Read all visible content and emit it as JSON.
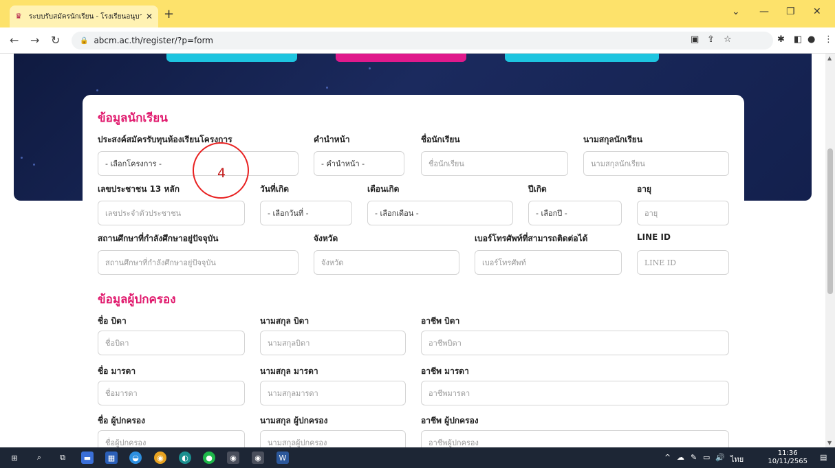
{
  "browser": {
    "tab_title": "ระบบรับสมัครนักเรียน - โรงเรียนอนุบาล",
    "new_tab": "+",
    "url": "abcm.ac.th/register/?p=form",
    "window": {
      "minimize": "—",
      "maximize": "❐",
      "close": "✕",
      "caret": "⌄"
    }
  },
  "student_section": {
    "title": "ข้อมูลนักเรียน",
    "project_label": "ประสงค์สมัครรับทุนห้องเรียนโครงการ",
    "project_value": "- เลือกโครงการ -",
    "prefix_label": "คำนำหน้า",
    "prefix_value": "- คำนำหน้า -",
    "first_name_label": "ชื่อนักเรียน",
    "first_name_placeholder": "ชื่อนักเรียน",
    "last_name_label": "นามสกุลนักเรียน",
    "last_name_placeholder": "นามสกุลนักเรียน",
    "id_label": "เลขประชาชน 13 หลัก",
    "id_placeholder": "เลขประจำตัวประชาชน",
    "birth_day_label": "วันที่เกิด",
    "birth_day_value": "- เลือกวันที่ -",
    "birth_month_label": "เดือนเกิด",
    "birth_month_value": "- เลือกเดือน -",
    "birth_year_label": "ปีเกิด",
    "birth_year_value": "- เลือกปี -",
    "age_label": "อายุ",
    "age_placeholder": "อายุ",
    "school_label": "สถานศึกษาที่กำลังศึกษาอยู่ปัจจุบัน",
    "school_placeholder": "สถานศึกษาที่กำลังศึกษาอยู่ปัจจุบัน",
    "province_label": "จังหวัด",
    "province_placeholder": "จังหวัด",
    "phone_label": "เบอร์โทรศัพท์ที่สามารถติดต่อได้",
    "phone_placeholder": "เบอร์โทรศัพท์",
    "line_label": "LINE ID",
    "line_placeholder": "LINE ID"
  },
  "guardian_section": {
    "title": "ข้อมูลผู้ปกครอง",
    "father_name_label": "ชื่อ บิดา",
    "father_name_placeholder": "ชื่อบิดา",
    "father_last_label": "นามสกุล บิดา",
    "father_last_placeholder": "นามสกุลบิดา",
    "father_job_label": "อาชีพ บิดา",
    "father_job_placeholder": "อาชีพบิดา",
    "mother_name_label": "ชื่อ มารดา",
    "mother_name_placeholder": "ชื่อมารดา",
    "mother_last_label": "นามสกุล มารดา",
    "mother_last_placeholder": "นามสกุลมารดา",
    "mother_job_label": "อาชีพ มารดา",
    "mother_job_placeholder": "อาชีพมารดา",
    "guardian_name_label": "ชื่อ ผู้ปกครอง",
    "guardian_name_placeholder": "ชื่อผู้ปกครอง",
    "guardian_last_label": "นามสกุล ผู้ปกครอง",
    "guardian_last_placeholder": "นามสกุลผู้ปกครอง",
    "guardian_job_label": "อาชีพ ผู้ปกครอง",
    "guardian_job_placeholder": "อาชีพผู้ปกครอง"
  },
  "annotation": {
    "number": "4",
    "color": "#e82020"
  },
  "taskbar": {
    "language": "ไทย",
    "time": "11:36",
    "date": "10/11/2565"
  },
  "colors": {
    "accent": "#e0186c",
    "tab_bar": "#fde26b",
    "hero": "#13204d",
    "btn_cyan": "#1ec5e0",
    "btn_magenta": "#e01a8c"
  }
}
